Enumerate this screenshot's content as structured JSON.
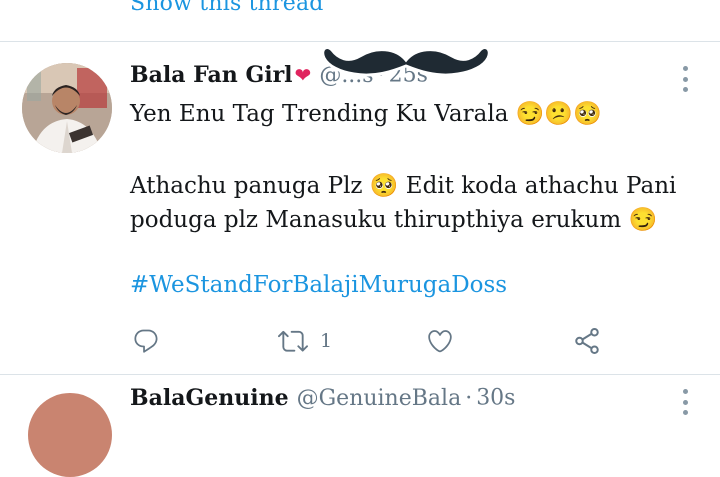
{
  "thread_link": "Show this thread",
  "tweet": {
    "display_name": "Bala Fan Girl",
    "name_emoji": "❤",
    "handle_visible": "@...s",
    "separator": "·",
    "time": "25s",
    "lines": [
      "Yen Enu Tag Trending Ku Varala 😏😕🥺",
      "",
      "Athachu panuga Plz 🥺  Edit koda athachu Pani",
      "poduga plz Manasuku thirupthiya erukum 😏"
    ],
    "hashtag": "#WeStandForBalajiMurugaDoss",
    "actions": {
      "reply_count": "",
      "retweet_count": "1",
      "like_count": ""
    }
  },
  "next_tweet": {
    "display_name": "BalaGenuine",
    "handle": "@GenuineBala",
    "separator": "·",
    "time": "30s"
  },
  "colors": {
    "link_blue": "#1b95e0",
    "text": "#14171a",
    "muted": "#657786",
    "divider": "#dce3e8",
    "heart": "#e0245e"
  },
  "icons": [
    "reply-icon",
    "retweet-icon",
    "like-icon",
    "share-icon",
    "more-icon",
    "mustache-sticker",
    "avatar"
  ]
}
